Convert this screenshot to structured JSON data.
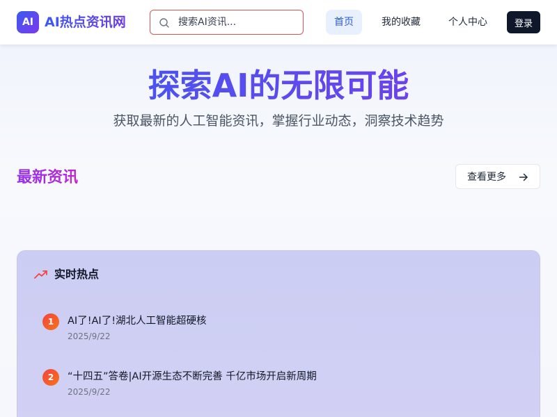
{
  "header": {
    "logo_badge": "AI",
    "logo_text": "AI热点资讯网",
    "search": {
      "placeholder": "搜索AI资讯...",
      "value": ""
    },
    "nav": [
      {
        "label": "首页",
        "active": true
      },
      {
        "label": "我的收藏",
        "active": false
      },
      {
        "label": "个人中心",
        "active": false
      }
    ],
    "login_label": "登录"
  },
  "hero": {
    "title": "探索AI的无限可能",
    "subtitle": "获取最新的人工智能资讯，掌握行业动态，洞察技术趋势"
  },
  "latest": {
    "title": "最新资讯",
    "more_label": "查看更多"
  },
  "hot": {
    "title": "实时热点",
    "icon": "trending-up-icon",
    "items": [
      {
        "rank": "1",
        "headline": "AI了!AI了!湖北人工智能超硬核",
        "date": "2025/9/22"
      },
      {
        "rank": "2",
        "headline": "“十四五”答卷|AI开源生态不断完善 千亿市场开启新周期",
        "date": "2025/9/22"
      }
    ]
  },
  "colors": {
    "brand_gradient_start": "#3b5bf0",
    "brand_gradient_end": "#7c3aed",
    "nav_active_bg": "#e8f0fe",
    "nav_active_text": "#2e5bd8",
    "login_bg": "#0f172a",
    "rank_badge": "#f05a2b",
    "hot_panel_bg": "#cfcff4",
    "search_border": "#d9534f"
  }
}
